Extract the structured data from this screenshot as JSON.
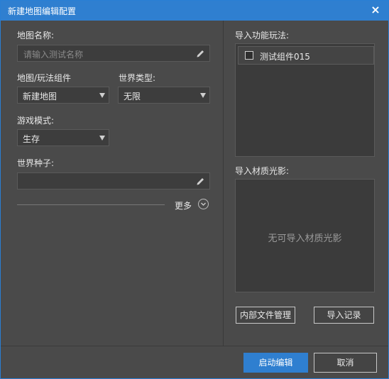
{
  "dialog": {
    "title": "新建地图编辑配置",
    "close_label": "×"
  },
  "left": {
    "map_name_label": "地图名称:",
    "map_name_placeholder": "请输入测试名称",
    "component_label": "地图/玩法组件",
    "component_value": "新建地图",
    "world_type_label": "世界类型:",
    "world_type_value": "无限",
    "game_mode_label": "游戏模式:",
    "game_mode_value": "生存",
    "seed_label": "世界种子:",
    "seed_value": "",
    "more_label": "更多"
  },
  "right": {
    "import_feature_label": "导入功能玩法:",
    "feature_items": [
      {
        "label": "测试组件015",
        "checked": false
      }
    ],
    "import_material_label": "导入材质光影:",
    "material_empty_text": "无可导入材质光影",
    "internal_files_button": "内部文件管理",
    "import_record_button": "导入记录"
  },
  "footer": {
    "start_button": "启动编辑",
    "cancel_button": "取消"
  },
  "colors": {
    "accent": "#2f7fd0",
    "background": "#4a4a4a",
    "panel": "#3b3b3b"
  }
}
